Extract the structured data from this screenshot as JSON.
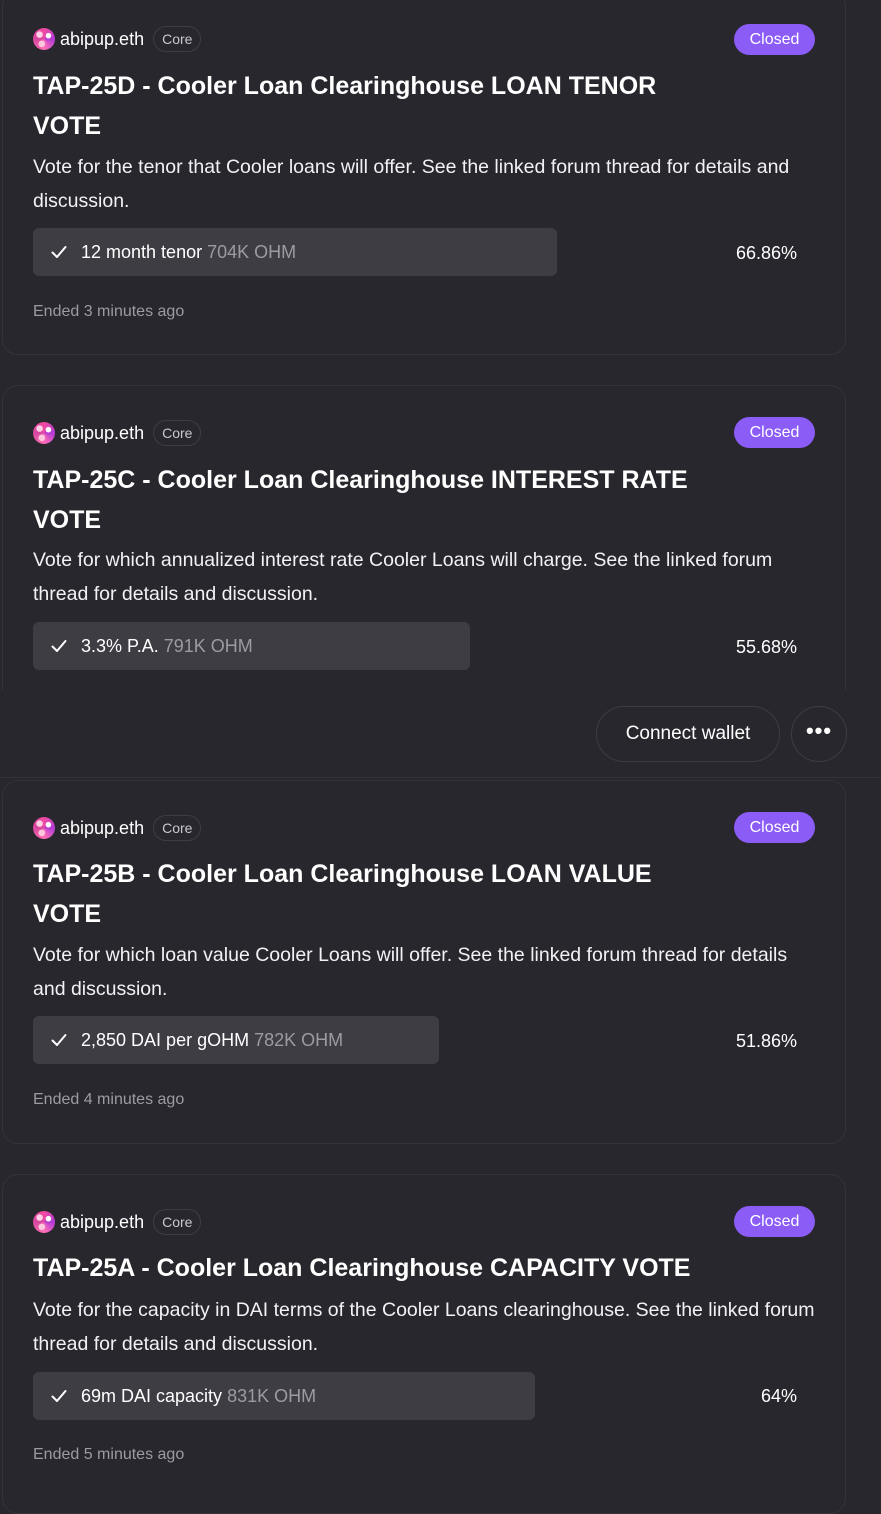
{
  "header": {
    "connect_wallet_label": "Connect wallet",
    "more_label": "•••"
  },
  "accent_color": "#8b5cf6",
  "proposals": [
    {
      "author": "abipup.eth",
      "role_badge": "Core",
      "status": "Closed",
      "title_line1": "TAP-25D - Cooler Loan Clearinghouse LOAN TENOR",
      "title_line2": "VOTE",
      "description": "Vote for the tenor that Cooler loans will offer. See the linked forum thread for details and discussion.",
      "winning_choice": "12 month tenor",
      "winning_votes": "704K OHM",
      "winning_percent": "66.86%",
      "ended": "Ended 3 minutes ago"
    },
    {
      "author": "abipup.eth",
      "role_badge": "Core",
      "status": "Closed",
      "title_line1": "TAP-25C - Cooler Loan Clearinghouse INTEREST RATE",
      "title_line2": "VOTE",
      "description": "Vote for which annualized interest rate Cooler Loans will charge. See the linked forum thread for details and discussion.",
      "winning_choice": "3.3% P.A.",
      "winning_votes": "791K OHM",
      "winning_percent": "55.68%"
    },
    {
      "author": "abipup.eth",
      "role_badge": "Core",
      "status": "Closed",
      "title_line1": "TAP-25B - Cooler Loan Clearinghouse LOAN VALUE",
      "title_line2": "VOTE",
      "description": "Vote for which loan value Cooler Loans will offer. See the linked forum thread for details and discussion.",
      "winning_choice": "2,850 DAI per gOHM",
      "winning_votes": "782K OHM",
      "winning_percent": "51.86%",
      "ended": "Ended 4 minutes ago"
    },
    {
      "author": "abipup.eth",
      "role_badge": "Core",
      "status": "Closed",
      "title_line1": "TAP-25A - Cooler Loan Clearinghouse CAPACITY VOTE",
      "title_line2": "",
      "description": "Vote for the capacity in DAI terms of the Cooler Loans clearinghouse. See the linked forum thread for details and discussion.",
      "winning_choice": "69m DAI capacity",
      "winning_votes": "831K OHM",
      "winning_percent": "64%",
      "ended": "Ended 5 minutes ago"
    }
  ]
}
